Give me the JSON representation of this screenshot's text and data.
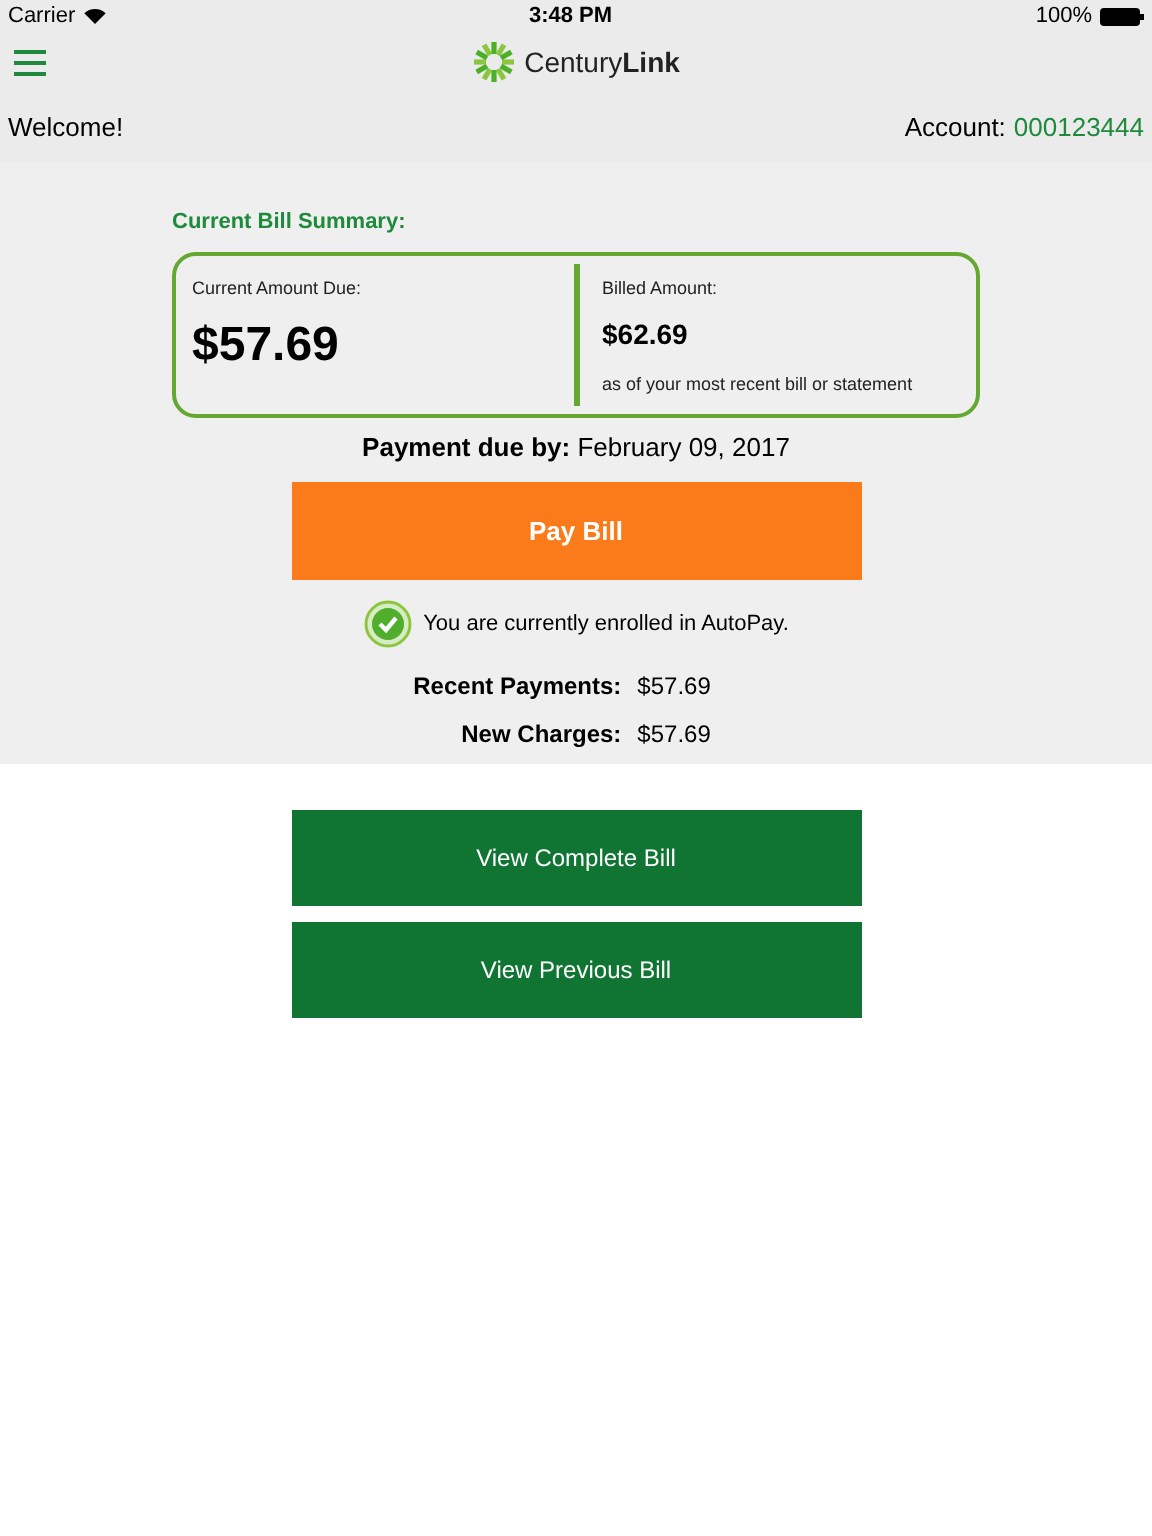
{
  "status_bar": {
    "carrier": "Carrier",
    "time": "3:48 PM",
    "battery": "100%"
  },
  "header": {
    "logo": "Century**Link**",
    "welcome": "Welcome!",
    "account_label": "Account:",
    "account_number": "000123444"
  },
  "summary": {
    "title": "Current Bill Summary:",
    "current_label": "Current Amount Due:",
    "current_amount": "$57.69",
    "billed_label": "Billed Amount:",
    "billed_amount": "$62.69",
    "billed_note": "as of your most recent bill or statement"
  },
  "payment_due": "**Payment due by:** February 09, 2017",
  "pay_button": "Pay Bill",
  "autopay": {
    "enrolled": true,
    "text": "You are currently enrolled in AutoPay."
  },
  "totals": [
    {
      "label": "Recent Payments:",
      "value": "$57.69"
    },
    {
      "label": "New Charges:",
      "value": "$57.69"
    }
  ],
  "buttons": [
    "View Complete Bill",
    "View Previous Bill"
  ]
}
